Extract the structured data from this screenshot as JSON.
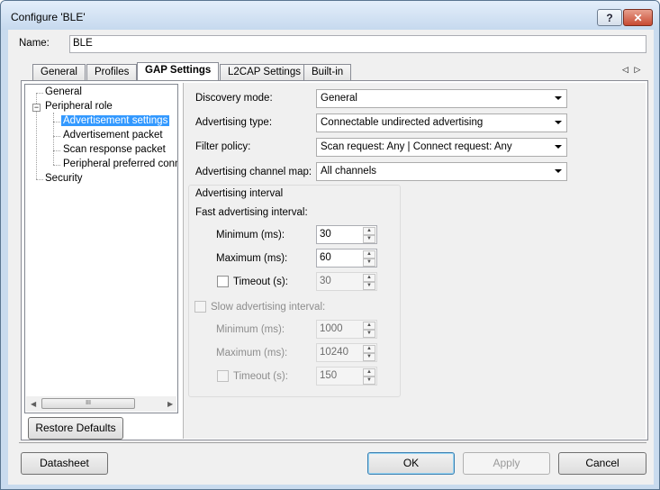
{
  "window": {
    "title": "Configure 'BLE'",
    "help": "?",
    "close": "✕"
  },
  "name": {
    "label": "Name:",
    "value": "BLE"
  },
  "tabs": [
    "General",
    "Profiles",
    "GAP Settings",
    "L2CAP Settings",
    "Built-in"
  ],
  "tab_nav": {
    "prev": "◁",
    "next": "▷"
  },
  "tree": {
    "items": [
      "General",
      "Peripheral role",
      "Advertisement settings",
      "Advertisement packet",
      "Scan response packet",
      "Peripheral preferred conne",
      "Security"
    ],
    "expander": "−",
    "scroll_left": "◀",
    "scroll_right": "▶",
    "scroll_grip": "III"
  },
  "restore_button": "Restore Defaults",
  "settings": {
    "discovery_mode": {
      "label": "Discovery mode:",
      "value": "General"
    },
    "advertising_type": {
      "label": "Advertising type:",
      "value": "Connectable undirected advertising"
    },
    "filter_policy": {
      "label": "Filter policy:",
      "value": "Scan request: Any | Connect request: Any"
    },
    "channel_map": {
      "label": "Advertising channel map:",
      "value": "All channels"
    }
  },
  "interval": {
    "title": "Advertising interval",
    "fast": {
      "label": "Fast advertising interval:",
      "min_label": "Minimum (ms):",
      "min_value": "30",
      "max_label": "Maximum (ms):",
      "max_value": "60",
      "timeout_label": "Timeout (s):",
      "timeout_value": "30"
    },
    "slow": {
      "label": "Slow advertising interval:",
      "min_label": "Minimum (ms):",
      "min_value": "1000",
      "max_label": "Maximum (ms):",
      "max_value": "10240",
      "timeout_label": "Timeout (s):",
      "timeout_value": "150"
    }
  },
  "spin_up": "▲",
  "spin_down": "▼",
  "buttons": {
    "datasheet": "Datasheet",
    "ok": "OK",
    "apply": "Apply",
    "cancel": "Cancel"
  }
}
